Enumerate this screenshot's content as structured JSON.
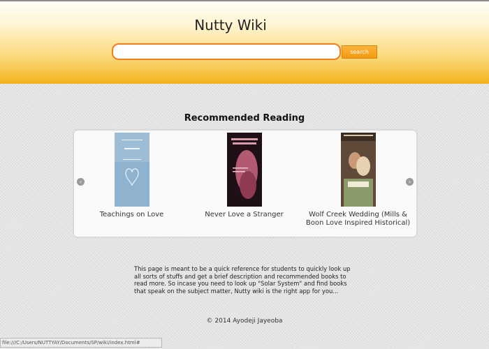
{
  "site": {
    "title": "Nutty Wiki"
  },
  "search": {
    "placeholder": "",
    "value": "",
    "button_label": "search"
  },
  "recommended": {
    "heading": "Recommended Reading",
    "books": [
      {
        "caption": "Teachings on Love"
      },
      {
        "caption": "Never Love a Stranger"
      },
      {
        "caption": "Wolf Creek Wedding (Mills & Boon Love Inspired Historical)"
      }
    ]
  },
  "description": "This page is meant to be a quick reference for students to quickly look up all sorts of stuffs and get a brief description and recommended books to read more. So incase you need to look up \"Solar System\" and find books that speak on the subject matter, Nutty wiki is the right app for you...",
  "footer": {
    "copyright": "© 2014 Ayodeji Jayeoba"
  },
  "status": {
    "url": "file:///C:/Users/NUTTYAY/Documents/SP/wiki/index.html#"
  },
  "colors": {
    "accent": "#f39a10",
    "header_top": "#fffef8",
    "header_bottom": "#f3b21c"
  },
  "icons": {
    "prev": "chevron-left-icon",
    "next": "chevron-right-icon"
  }
}
